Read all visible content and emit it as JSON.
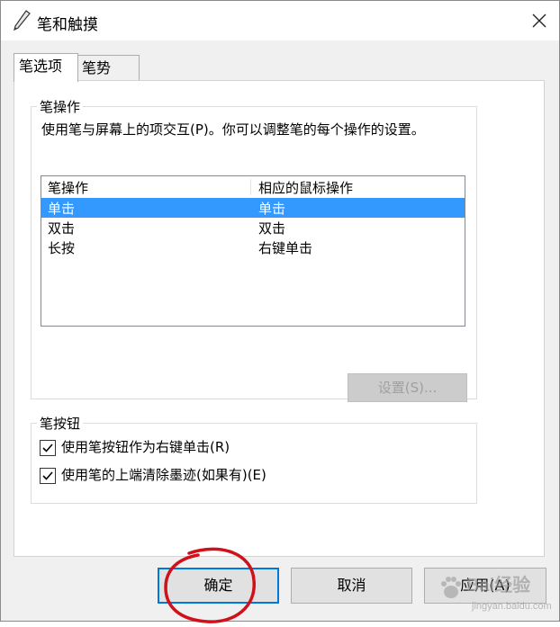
{
  "window": {
    "title": "笔和触摸",
    "icon": "pen-icon",
    "close_icon": "close-icon"
  },
  "tabs": [
    {
      "label": "笔选项",
      "active": true
    },
    {
      "label": "笔势",
      "active": false
    }
  ],
  "pen_actions": {
    "group_label": "笔操作",
    "description": "使用笔与屏幕上的项交互(P)。你可以调整笔的每个操作的设置。",
    "columns": [
      "笔操作",
      "相应的鼠标操作"
    ],
    "rows": [
      {
        "action": "单击",
        "mouse": "单击",
        "selected": true
      },
      {
        "action": "双击",
        "mouse": "双击",
        "selected": false
      },
      {
        "action": "长按",
        "mouse": "右键单击",
        "selected": false
      }
    ],
    "settings_button": "设置(S)..."
  },
  "pen_buttons": {
    "group_label": "笔按钮",
    "options": [
      {
        "label": "使用笔按钮作为右键单击(R)",
        "checked": true
      },
      {
        "label": "使用笔的上端清除墨迹(如果有)(E)",
        "checked": true
      }
    ]
  },
  "footer": {
    "ok": "确定",
    "cancel": "取消",
    "apply": "应用(A)"
  },
  "watermark": {
    "main": "Bai经验",
    "sub": "jingyan.baidu.com"
  },
  "colors": {
    "selection": "#3399ff",
    "focus_border": "#0078d7",
    "annotation": "#d0101a"
  }
}
